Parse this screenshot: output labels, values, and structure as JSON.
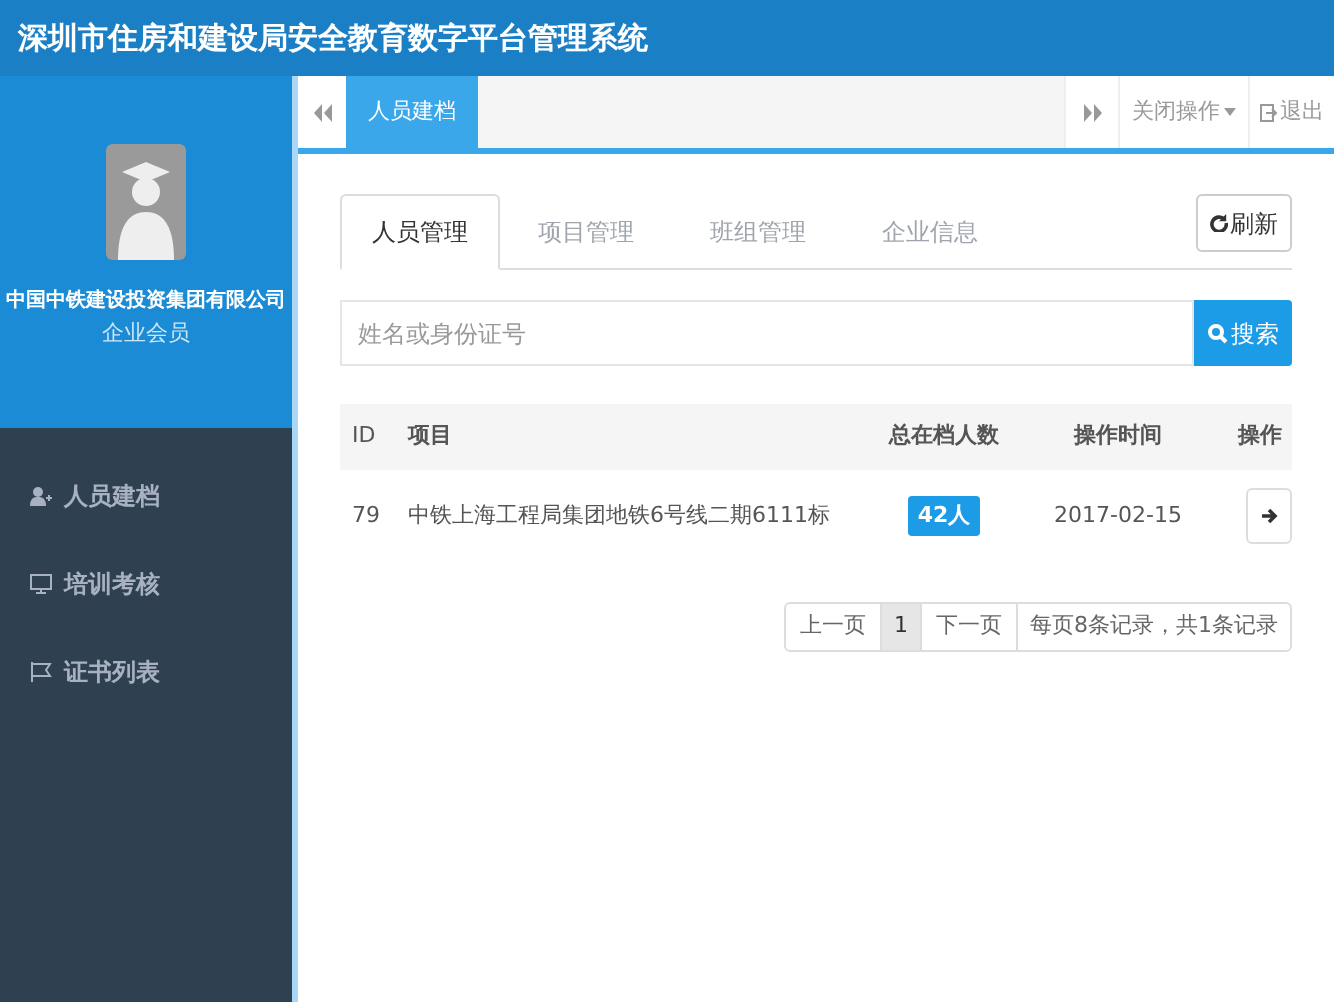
{
  "header": {
    "title": "深圳市住房和建设局安全教育数字平台管理系统"
  },
  "profile": {
    "company": "中国中铁建设投资集团有限公司",
    "role": "企业会员"
  },
  "sidebar": {
    "items": [
      {
        "label": "人员建档"
      },
      {
        "label": "培训考核"
      },
      {
        "label": "证书列表"
      }
    ]
  },
  "page_tabs": {
    "items": [
      {
        "label": "人员建档",
        "selected": true
      }
    ],
    "close_menu": "关闭操作",
    "logout": "退出"
  },
  "tabs": [
    {
      "label": "人员管理",
      "selected": true
    },
    {
      "label": "项目管理",
      "selected": false
    },
    {
      "label": "班组管理",
      "selected": false
    },
    {
      "label": "企业信息",
      "selected": false
    }
  ],
  "refresh": "刷新",
  "search": {
    "placeholder": "姓名或身份证号",
    "button": "搜索"
  },
  "table": {
    "columns": [
      "ID",
      "项目",
      "总在档人数",
      "操作时间",
      "操作"
    ],
    "rows": [
      {
        "id": "79",
        "project": "中铁上海工程局集团地铁6号线二期6111标",
        "count": "42人",
        "time": "2017-02-15"
      }
    ]
  },
  "pagination": {
    "prev": "上一页",
    "pages": [
      {
        "label": "1",
        "selected": true
      }
    ],
    "next": "下一页",
    "info": "每页8条记录，共1条记录"
  }
}
